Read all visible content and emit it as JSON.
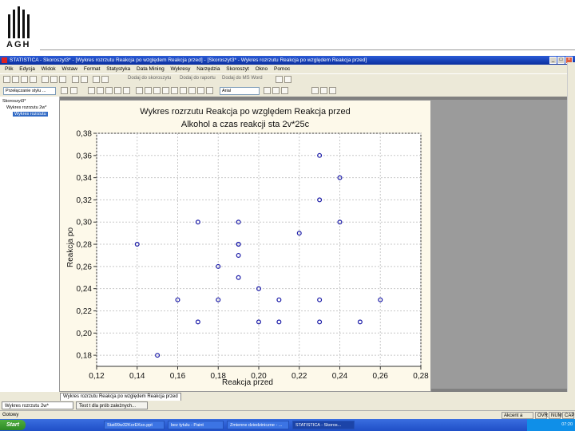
{
  "header": {
    "logo_text": "AGH"
  },
  "window": {
    "title": "STATISTICA - Skoroszyt3* - [Wykres rozrzutu   Reakcja po względem Reakcja przed] - [Skoroszyt3* - Wykres rozrzutu   Reakcja po względem Reakcja przed]",
    "minimize": "_",
    "maximize": "□",
    "close": "×"
  },
  "menu": [
    "Plik",
    "Edycja",
    "Widok",
    "Wstaw",
    "Format",
    "Statystyka",
    "Data Mining",
    "Wykresy",
    "Narzędzia",
    "Skoroszyt",
    "Okno",
    "Pomoc"
  ],
  "toolbar": {
    "combo1": "Dodaj do skoroszytu",
    "combo2": "Dodaj do raportu",
    "combo3": "Dodaj do MS Word",
    "font_combo": "Arial",
    "style_combo": "Przełączanie stylu ..."
  },
  "tree": {
    "root": "Skoroszyt3*",
    "folder": "Wykres rozrzutu 2w*",
    "leaf": "Wykres rozrzutu"
  },
  "tabs": {
    "doc_tab": "Wykres rozrzutu   Reakcja po względem Reakcja przed"
  },
  "taskbar_docs": [
    {
      "label": "Wykres rozrzutu 2w*"
    },
    {
      "label": "Test t dla prób zależnych..."
    }
  ],
  "status": {
    "left": "Gotowy",
    "right1": "Akcent a czas",
    "right2": "OVR",
    "right3": "NUM",
    "right4": "CAP"
  },
  "os_taskbar": {
    "start": "Start",
    "buttons": [
      "Stat99w32KorEKso.ppt",
      "bez tytułu - Paint",
      "Zmienne dziedziniczne - ...",
      "STATISTICA - Skoros..."
    ],
    "clock": "07:20"
  },
  "chart_data": {
    "type": "scatter",
    "title": "Wykres rozrzutu   Reakcja po względem Reakcja przed",
    "subtitle": "Alkohol a czas reakcji sta 2v*25c",
    "xlabel": "Reakcja przed",
    "ylabel": "Reakcja po",
    "xlim": [
      0.12,
      0.28
    ],
    "ylim": [
      0.17,
      0.38
    ],
    "xticks": [
      "0,12",
      "0,14",
      "0,16",
      "0,18",
      "0,20",
      "0,22",
      "0,24",
      "0,26",
      "0,28"
    ],
    "yticks": [
      "0,18",
      "0,20",
      "0,22",
      "0,24",
      "0,26",
      "0,28",
      "0,30",
      "0,32",
      "0,34",
      "0,36",
      "0,38"
    ],
    "grid": true,
    "marker_color": "#1c1ca8",
    "points": [
      {
        "x": 0.14,
        "y": 0.28
      },
      {
        "x": 0.15,
        "y": 0.18
      },
      {
        "x": 0.16,
        "y": 0.23
      },
      {
        "x": 0.17,
        "y": 0.3
      },
      {
        "x": 0.17,
        "y": 0.21
      },
      {
        "x": 0.18,
        "y": 0.26
      },
      {
        "x": 0.18,
        "y": 0.23
      },
      {
        "x": 0.19,
        "y": 0.3
      },
      {
        "x": 0.19,
        "y": 0.28
      },
      {
        "x": 0.19,
        "y": 0.28
      },
      {
        "x": 0.19,
        "y": 0.27
      },
      {
        "x": 0.19,
        "y": 0.25
      },
      {
        "x": 0.2,
        "y": 0.24
      },
      {
        "x": 0.2,
        "y": 0.21
      },
      {
        "x": 0.21,
        "y": 0.23
      },
      {
        "x": 0.21,
        "y": 0.21
      },
      {
        "x": 0.22,
        "y": 0.29
      },
      {
        "x": 0.23,
        "y": 0.36
      },
      {
        "x": 0.23,
        "y": 0.32
      },
      {
        "x": 0.23,
        "y": 0.23
      },
      {
        "x": 0.23,
        "y": 0.21
      },
      {
        "x": 0.24,
        "y": 0.34
      },
      {
        "x": 0.24,
        "y": 0.3
      },
      {
        "x": 0.25,
        "y": 0.21
      },
      {
        "x": 0.26,
        "y": 0.23
      }
    ]
  }
}
